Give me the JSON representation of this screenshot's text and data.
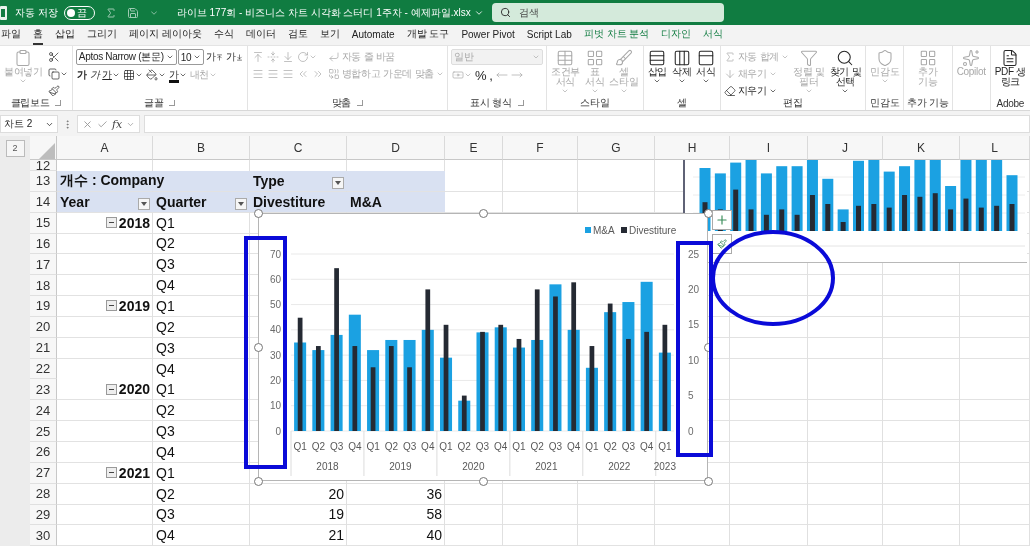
{
  "title_bar": {
    "autosave_label": "자동 저장",
    "autosave": {
      "label": "끔",
      "on": false
    },
    "document_title": "라이브 177회 - 비즈니스 차트 시각화 스터디 1주차 - 예제파일.xlsx",
    "search_placeholder": "검색"
  },
  "tabs": [
    {
      "label": "파일",
      "selected": false,
      "contextual": false
    },
    {
      "label": "홈",
      "selected": true,
      "contextual": false
    },
    {
      "label": "삽입",
      "selected": false,
      "contextual": false
    },
    {
      "label": "그리기",
      "selected": false,
      "contextual": false
    },
    {
      "label": "페이지 레이아웃",
      "selected": false,
      "contextual": false
    },
    {
      "label": "수식",
      "selected": false,
      "contextual": false
    },
    {
      "label": "데이터",
      "selected": false,
      "contextual": false
    },
    {
      "label": "검토",
      "selected": false,
      "contextual": false
    },
    {
      "label": "보기",
      "selected": false,
      "contextual": false
    },
    {
      "label": "Automate",
      "selected": false,
      "contextual": false
    },
    {
      "label": "개발 도구",
      "selected": false,
      "contextual": false
    },
    {
      "label": "Power Pivot",
      "selected": false,
      "contextual": false
    },
    {
      "label": "Script Lab",
      "selected": false,
      "contextual": false
    },
    {
      "label": "피벗 차트 분석",
      "selected": false,
      "contextual": true
    },
    {
      "label": "디자인",
      "selected": false,
      "contextual": true
    },
    {
      "label": "서식",
      "selected": false,
      "contextual": true
    }
  ],
  "ribbon": {
    "groups": [
      {
        "label": "클립보드",
        "launcher": true,
        "items": [
          {
            "kind": "large",
            "label": "붙여넣기",
            "dropdown": true,
            "disabled": true
          },
          {
            "kind": "stack",
            "items": [
              {
                "kind": "icon",
                "dropdown": false,
                "disabled": false
              },
              {
                "kind": "icon",
                "dropdown": true,
                "disabled": false
              },
              {
                "kind": "icon",
                "dropdown": false,
                "disabled": false
              }
            ]
          }
        ]
      },
      {
        "label": "글꼴",
        "launcher": true,
        "items": [
          {
            "kind": "stack",
            "items": [
              {
                "kind": "row",
                "items": [
                  {
                    "kind": "field",
                    "value": "Aptos Narrow (본문)",
                    "wide": true,
                    "dropdown": true,
                    "disabled": false
                  },
                  {
                    "kind": "field",
                    "value": "10",
                    "wide": false,
                    "dropdown": true,
                    "disabled": false
                  },
                  {
                    "kind": "grow",
                    "label": "가",
                    "dropdown": false,
                    "disabled": false
                  },
                  {
                    "kind": "shrink",
                    "label": "가",
                    "dropdown": false,
                    "disabled": false
                  }
                ]
              },
              {
                "kind": "row",
                "items": [
                  {
                    "kind": "bold",
                    "label": "가",
                    "dropdown": false,
                    "disabled": false
                  },
                  {
                    "kind": "italic",
                    "label": "가",
                    "dropdown": false,
                    "disabled": false
                  },
                  {
                    "kind": "underline",
                    "label": "가",
                    "dropdown": true,
                    "disabled": false
                  },
                  {
                    "kind": "icon",
                    "dropdown": true,
                    "disabled": false
                  },
                  {
                    "kind": "icon",
                    "dropdown": true,
                    "disabled": false
                  },
                  {
                    "kind": "color",
                    "label": "가",
                    "dropdown": true,
                    "disabled": false
                  },
                  {
                    "kind": "phonetic",
                    "label": "내천",
                    "dropdown": true,
                    "disabled": true
                  }
                ]
              }
            ]
          }
        ]
      },
      {
        "label": "맞춤",
        "launcher": true,
        "items": [
          {
            "kind": "stack",
            "items": [
              {
                "kind": "row",
                "items": [
                  {
                    "kind": "icon",
                    "dropdown": false,
                    "disabled": true
                  },
                  {
                    "kind": "icon",
                    "dropdown": false,
                    "disabled": true
                  },
                  {
                    "kind": "icon",
                    "dropdown": false,
                    "disabled": true
                  },
                  {
                    "kind": "icon",
                    "dropdown": true,
                    "disabled": true
                  }
                ]
              },
              {
                "kind": "row",
                "items": [
                  {
                    "kind": "icon",
                    "dropdown": false,
                    "disabled": true
                  },
                  {
                    "kind": "icon",
                    "dropdown": false,
                    "disabled": true
                  },
                  {
                    "kind": "icon",
                    "dropdown": false,
                    "disabled": true
                  },
                  {
                    "kind": "icon",
                    "dropdown": false,
                    "disabled": true
                  },
                  {
                    "kind": "icon",
                    "dropdown": false,
                    "disabled": true
                  }
                ]
              }
            ]
          },
          {
            "kind": "stack",
            "items": [
              {
                "kind": "small",
                "label": "자동 줄 바꿈",
                "dropdown": false,
                "disabled": true
              },
              {
                "kind": "small",
                "label": "병합하고 가운데 맞춤",
                "dropdown": true,
                "disabled": true
              }
            ]
          }
        ]
      },
      {
        "label": "표시 형식",
        "launcher": true,
        "items": [
          {
            "kind": "stack",
            "items": [
              {
                "kind": "field",
                "value": "일반",
                "wide": true,
                "dropdown": true,
                "disabled": true
              },
              {
                "kind": "row",
                "items": [
                  {
                    "kind": "icon",
                    "dropdown": true,
                    "disabled": true
                  },
                  {
                    "kind": "plain",
                    "label": "%",
                    "dropdown": false,
                    "disabled": false
                  },
                  {
                    "kind": "plain",
                    "label": ",",
                    "dropdown": false,
                    "disabled": false
                  },
                  {
                    "kind": "icon",
                    "dropdown": false,
                    "disabled": true
                  },
                  {
                    "kind": "icon",
                    "dropdown": false,
                    "disabled": true
                  }
                ]
              }
            ]
          }
        ]
      },
      {
        "label": "스타일",
        "launcher": false,
        "items": [
          {
            "kind": "large",
            "label": "조건부\n서식",
            "dropdown": true,
            "disabled": true
          },
          {
            "kind": "large",
            "label": "표\n서식",
            "dropdown": true,
            "disabled": true
          },
          {
            "kind": "large",
            "label": "셀\n스타일",
            "dropdown": true,
            "disabled": true
          }
        ]
      },
      {
        "label": "셀",
        "launcher": false,
        "items": [
          {
            "kind": "large",
            "label": "삽입",
            "dropdown": true,
            "disabled": false
          },
          {
            "kind": "large",
            "label": "삭제",
            "dropdown": true,
            "disabled": false
          },
          {
            "kind": "large",
            "label": "서식",
            "dropdown": true,
            "disabled": false
          }
        ]
      },
      {
        "label": "편집",
        "launcher": false,
        "items": [
          {
            "kind": "stack",
            "items": [
              {
                "kind": "small",
                "label": "자동 합계",
                "dropdown": true,
                "disabled": true
              },
              {
                "kind": "small",
                "label": "채우기",
                "dropdown": true,
                "disabled": true
              },
              {
                "kind": "small",
                "label": "지우기",
                "dropdown": true,
                "disabled": false
              }
            ]
          },
          {
            "kind": "large",
            "label": "정렬 및\n필터",
            "dropdown": true,
            "disabled": true
          },
          {
            "kind": "large",
            "label": "찾기 및\n선택",
            "dropdown": true,
            "disabled": false
          }
        ]
      },
      {
        "label": "민감도",
        "launcher": false,
        "items": [
          {
            "kind": "large",
            "label": "민감도",
            "dropdown": true,
            "disabled": true
          }
        ]
      },
      {
        "label": "추가 기능",
        "launcher": false,
        "items": [
          {
            "kind": "large",
            "label": "추가\n기능",
            "dropdown": false,
            "disabled": true
          }
        ]
      },
      {
        "items": [
          {
            "kind": "large",
            "label": "Copilot",
            "dropdown": false,
            "disabled": true
          }
        ]
      },
      {
        "label": "Adobe",
        "launcher": false,
        "items": [
          {
            "kind": "large",
            "label": "PDF 생\n링크",
            "dropdown": false,
            "disabled": false
          }
        ]
      }
    ]
  },
  "formula_bar": {
    "name_box": "차트 2",
    "function_label": "fx"
  },
  "sheet": {
    "outline_levels": [
      "2"
    ],
    "columns": [
      "A",
      "B",
      "C",
      "D",
      "E",
      "F",
      "G",
      "H",
      "I",
      "J",
      "K",
      "L"
    ],
    "rows": [
      {
        "header": "12"
      },
      {
        "header": "13",
        "cells": {
          "A": {
            "kind": "label",
            "text": "개수 : Company",
            "filter": false
          },
          "C": {
            "kind": "label",
            "text": "Type",
            "filter": true
          }
        }
      },
      {
        "header": "14",
        "cells": {
          "A": {
            "kind": "label",
            "text": "Year",
            "filter": true
          },
          "B": {
            "kind": "label",
            "text": "Quarter",
            "filter": true
          },
          "C": {
            "kind": "label",
            "text": "Divestiture",
            "filter": false
          },
          "D": {
            "kind": "label",
            "text": "M&A",
            "filter": false
          }
        }
      },
      {
        "header": "15",
        "cells": {
          "A": {
            "kind": "year",
            "text": "2018",
            "expanded": true
          },
          "B": {
            "kind": "text",
            "text": "Q1"
          }
        }
      },
      {
        "header": "16",
        "cells": {
          "B": {
            "kind": "text",
            "text": "Q2"
          }
        }
      },
      {
        "header": "17",
        "cells": {
          "B": {
            "kind": "text",
            "text": "Q3"
          }
        }
      },
      {
        "header": "18",
        "cells": {
          "B": {
            "kind": "text",
            "text": "Q4"
          }
        }
      },
      {
        "header": "19",
        "cells": {
          "A": {
            "kind": "year",
            "text": "2019",
            "expanded": true
          },
          "B": {
            "kind": "text",
            "text": "Q1"
          }
        }
      },
      {
        "header": "20",
        "cells": {
          "B": {
            "kind": "text",
            "text": "Q2"
          }
        }
      },
      {
        "header": "21",
        "cells": {
          "B": {
            "kind": "text",
            "text": "Q3"
          }
        }
      },
      {
        "header": "22",
        "cells": {
          "B": {
            "kind": "text",
            "text": "Q4"
          }
        }
      },
      {
        "header": "23",
        "cells": {
          "A": {
            "kind": "year",
            "text": "2020",
            "expanded": true
          },
          "B": {
            "kind": "text",
            "text": "Q1"
          }
        }
      },
      {
        "header": "24",
        "cells": {
          "B": {
            "kind": "text",
            "text": "Q2"
          }
        }
      },
      {
        "header": "25",
        "cells": {
          "B": {
            "kind": "text",
            "text": "Q3"
          }
        }
      },
      {
        "header": "26",
        "cells": {
          "B": {
            "kind": "text",
            "text": "Q4"
          }
        }
      },
      {
        "header": "27",
        "cells": {
          "A": {
            "kind": "year",
            "text": "2021",
            "expanded": true
          },
          "B": {
            "kind": "text",
            "text": "Q1"
          }
        }
      },
      {
        "header": "28",
        "cells": {
          "B": {
            "kind": "text",
            "text": "Q2"
          },
          "C": {
            "kind": "number",
            "text": "20"
          },
          "D": {
            "kind": "number",
            "text": "36"
          }
        }
      },
      {
        "header": "29",
        "cells": {
          "B": {
            "kind": "text",
            "text": "Q3"
          },
          "C": {
            "kind": "number",
            "text": "19"
          },
          "D": {
            "kind": "number",
            "text": "58"
          }
        }
      },
      {
        "header": "30",
        "cells": {
          "B": {
            "kind": "text",
            "text": "Q4"
          },
          "C": {
            "kind": "number",
            "text": "21"
          },
          "D": {
            "kind": "number",
            "text": "40"
          }
        }
      }
    ]
  },
  "pivot_chart": {
    "year_labels": [
      "2018",
      "2019",
      "2020",
      "2021",
      "2022",
      "2023"
    ],
    "chart_data": {
      "type": "bar",
      "grid": true,
      "legend": true,
      "categories": [
        "Q1",
        "Q2",
        "Q3",
        "Q4",
        "Q1",
        "Q2",
        "Q3",
        "Q4",
        "Q1",
        "Q2",
        "Q3",
        "Q4",
        "Q1",
        "Q2",
        "Q3",
        "Q4",
        "Q1",
        "Q2",
        "Q3",
        "Q4",
        "Q1"
      ],
      "series": [
        {
          "name": "M&A",
          "color": "#1ba1e2",
          "values": [
            35,
            32,
            38,
            46,
            32,
            36,
            36,
            40,
            29,
            12,
            39,
            41,
            33,
            36,
            58,
            40,
            25,
            47,
            51,
            59,
            31
          ]
        },
        {
          "name": "Divestiture",
          "color": "#252a33",
          "axis": "y2",
          "values": [
            16,
            12,
            23,
            12,
            9,
            12,
            9,
            20,
            15,
            5,
            14,
            15,
            13,
            20,
            19,
            21,
            12,
            18,
            13,
            14,
            15
          ]
        }
      ],
      "ylim": [
        0,
        70
      ],
      "yticks": [
        {
          "value": 0,
          "label": "0"
        },
        {
          "value": 10,
          "label": "10"
        },
        {
          "value": 20,
          "label": "20"
        },
        {
          "value": 30,
          "label": "30"
        },
        {
          "value": 40,
          "label": "40"
        },
        {
          "value": 50,
          "label": "50"
        },
        {
          "value": 60,
          "label": "60"
        },
        {
          "value": 70,
          "label": "70"
        }
      ],
      "y2lim": [
        0,
        25
      ],
      "y2ticks": [
        {
          "value": 0,
          "label": "0"
        },
        {
          "value": 5,
          "label": "5"
        },
        {
          "value": 10,
          "label": "10"
        },
        {
          "value": 15,
          "label": "15"
        },
        {
          "value": 20,
          "label": "20"
        },
        {
          "value": 25,
          "label": "25"
        }
      ]
    }
  }
}
